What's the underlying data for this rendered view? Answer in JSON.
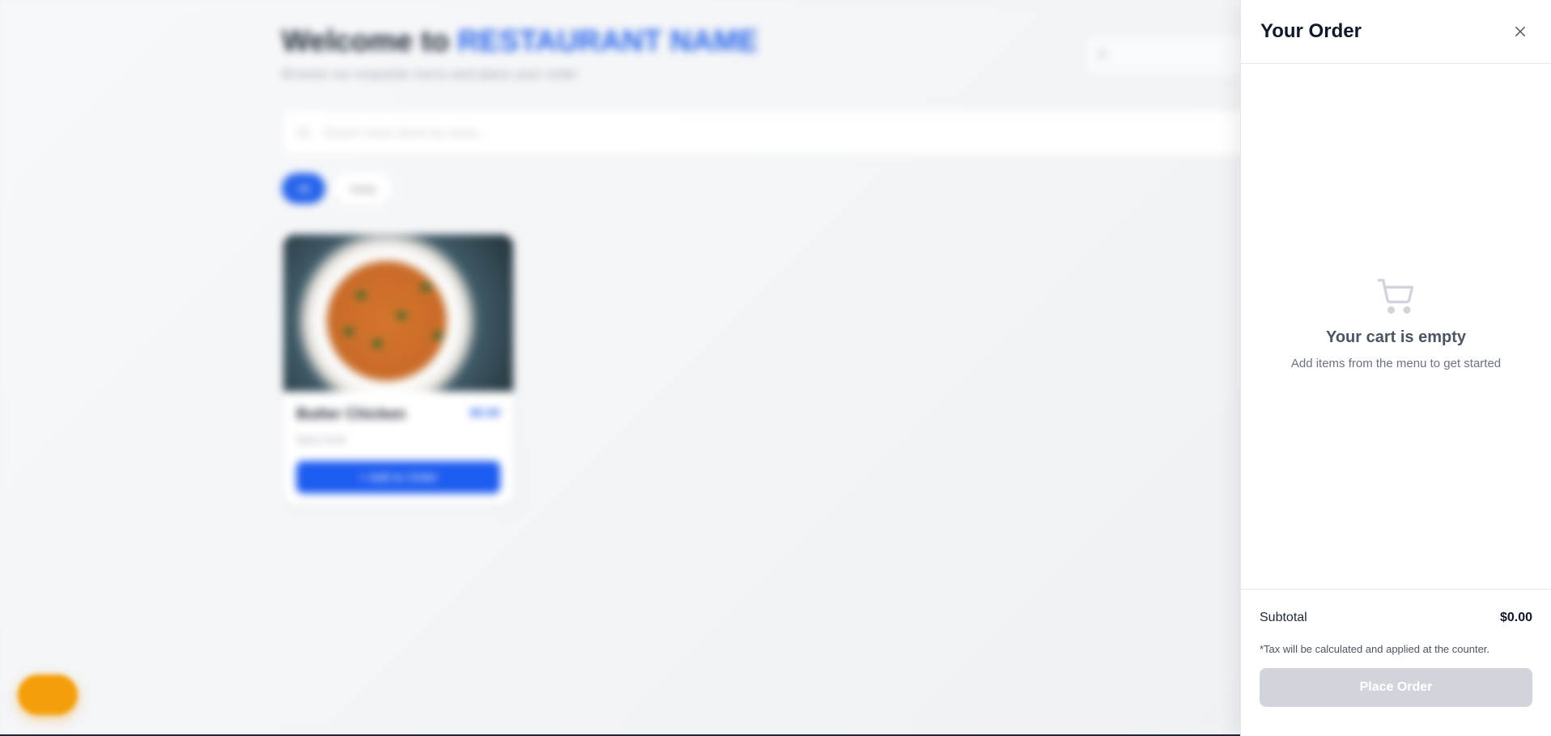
{
  "background": {
    "welcome_prefix": "Welcome to",
    "restaurant_name": "RESTAURANT NAME",
    "subtitle": "Browse our exquisite menu and place your order",
    "table_select_value": "2",
    "search_placeholder": "Search menu items by name...",
    "filters": [
      {
        "label": "All",
        "active": true
      },
      {
        "label": "Curry",
        "active": false
      }
    ],
    "menu_items": [
      {
        "name": "Butter Chicken",
        "price": "$0.00",
        "description": "Spicy food",
        "button_label": "+ Add to Order"
      }
    ]
  },
  "cart": {
    "title": "Your Order",
    "empty_title": "Your cart is empty",
    "empty_subtitle": "Add items from the menu to get started",
    "subtotal_label": "Subtotal",
    "subtotal_value": "$0.00",
    "tax_note": "*Tax will be calculated and applied at the counter.",
    "place_order_label": "Place Order"
  },
  "colors": {
    "accent": "#2563eb",
    "fab": "#f59e0b",
    "disabled_button": "#d1d5db"
  },
  "icons": {
    "close": "close-icon",
    "cart": "cart-icon",
    "search": "search-icon"
  }
}
